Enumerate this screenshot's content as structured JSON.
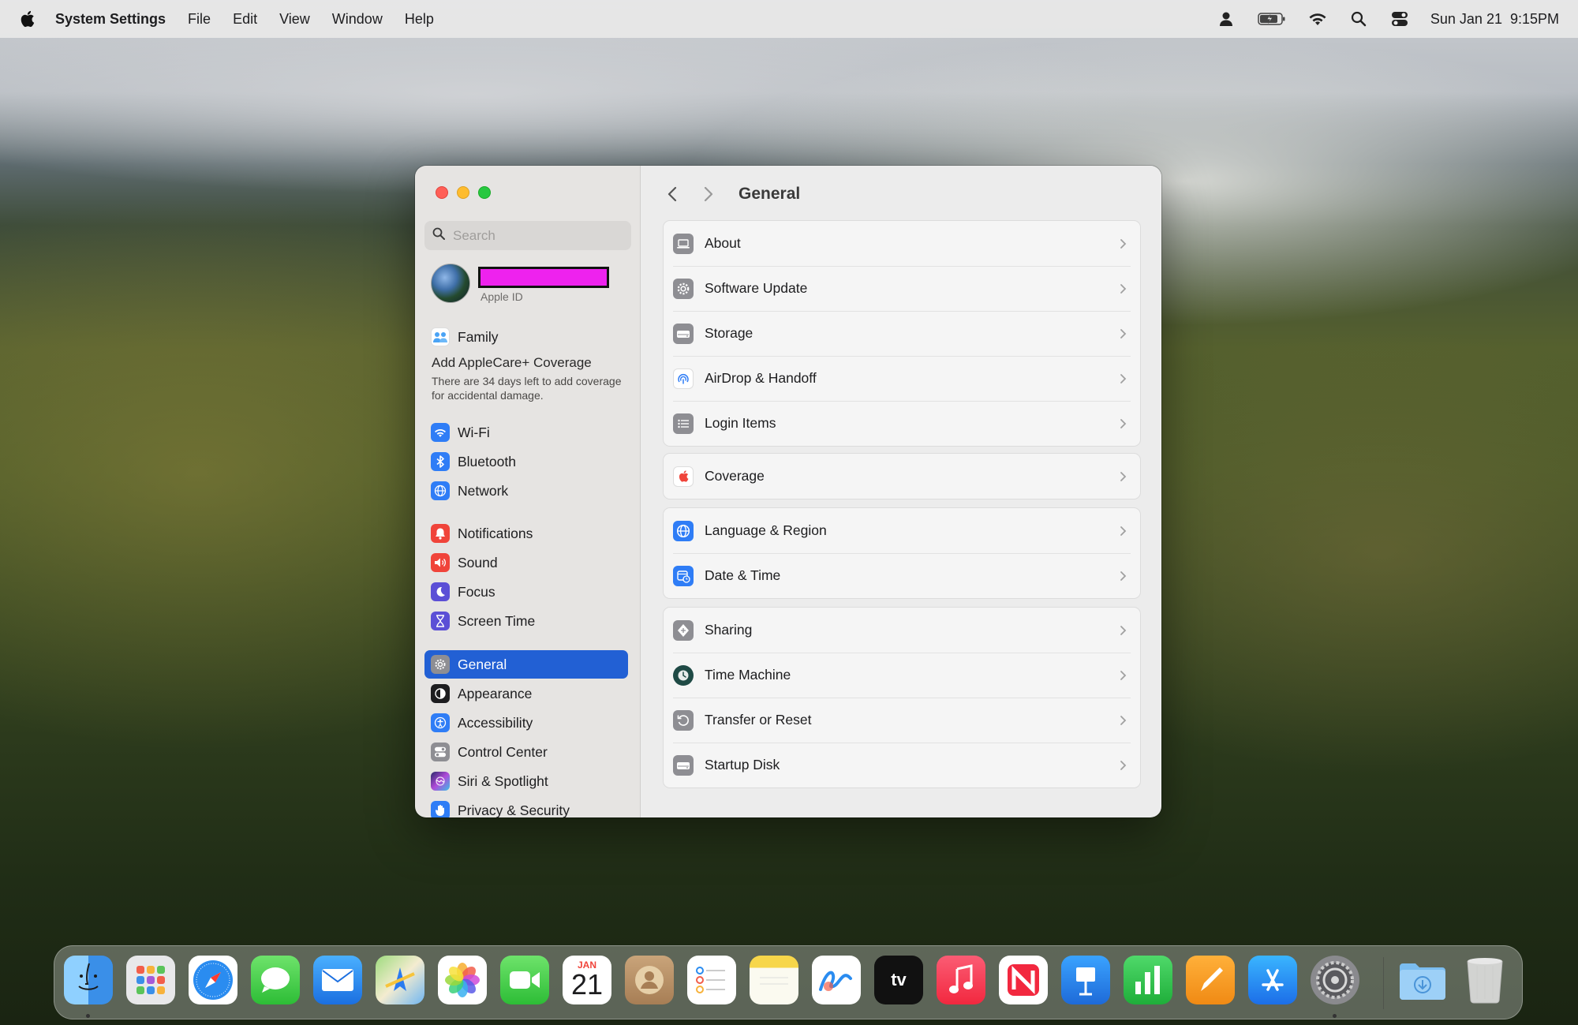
{
  "menubar": {
    "app_name": "System Settings",
    "menus": [
      "File",
      "Edit",
      "View",
      "Window",
      "Help"
    ],
    "datetime": "Sun Jan 21  9:15PM"
  },
  "sidebar": {
    "search_placeholder": "Search",
    "apple_id_caption": "Apple ID",
    "family_label": "Family",
    "applecare_title": "Add AppleCare+ Coverage",
    "applecare_desc": "There are 34 days left to add coverage for accidental damage.",
    "items": [
      {
        "label": "Wi-Fi",
        "icon": "wifi-icon",
        "color": "#2f7df6"
      },
      {
        "label": "Bluetooth",
        "icon": "bluetooth-icon",
        "color": "#2f7df6"
      },
      {
        "label": "Network",
        "icon": "globe-icon",
        "color": "#2f7df6"
      },
      {
        "label": "Notifications",
        "icon": "bell-icon",
        "color": "#f0443a"
      },
      {
        "label": "Sound",
        "icon": "speaker-icon",
        "color": "#f0443a"
      },
      {
        "label": "Focus",
        "icon": "moon-icon",
        "color": "#5b4fd6"
      },
      {
        "label": "Screen Time",
        "icon": "hourglass-icon",
        "color": "#5b4fd6"
      },
      {
        "label": "General",
        "icon": "gear-icon",
        "color": "#8e8e93"
      },
      {
        "label": "Appearance",
        "icon": "appearance-icon",
        "color": "#1d1d1f"
      },
      {
        "label": "Accessibility",
        "icon": "accessibility-icon",
        "color": "#2f7df6"
      },
      {
        "label": "Control Center",
        "icon": "control-center-icon",
        "color": "#8e8e93"
      },
      {
        "label": "Siri & Spotlight",
        "icon": "siri-icon",
        "color": "#b04ad8"
      },
      {
        "label": "Privacy & Security",
        "icon": "hand-icon",
        "color": "#2f7df6"
      }
    ]
  },
  "main": {
    "title": "General",
    "groups": [
      [
        {
          "label": "About",
          "icon": "laptop-icon"
        },
        {
          "label": "Software Update",
          "icon": "gear-badge-icon"
        },
        {
          "label": "Storage",
          "icon": "drive-icon"
        },
        {
          "label": "AirDrop & Handoff",
          "icon": "airdrop-icon"
        },
        {
          "label": "Login Items",
          "icon": "list-icon"
        }
      ],
      [
        {
          "label": "Coverage",
          "icon": "apple-icon"
        }
      ],
      [
        {
          "label": "Language & Region",
          "icon": "globe-icon"
        },
        {
          "label": "Date & Time",
          "icon": "calendar-clock-icon"
        }
      ],
      [
        {
          "label": "Sharing",
          "icon": "sharing-icon"
        },
        {
          "label": "Time Machine",
          "icon": "time-machine-icon"
        },
        {
          "label": "Transfer or Reset",
          "icon": "reset-icon"
        },
        {
          "label": "Startup Disk",
          "icon": "disk-icon"
        }
      ]
    ]
  },
  "dock": {
    "calendar_month": "JAN",
    "calendar_day": "21",
    "apps": [
      "Finder",
      "Launchpad",
      "Safari",
      "Messages",
      "Mail",
      "Maps",
      "Photos",
      "FaceTime",
      "Calendar",
      "Contacts",
      "Reminders",
      "Notes",
      "Freeform",
      "TV",
      "Music",
      "News",
      "Keynote",
      "Numbers",
      "Pages",
      "App Store",
      "System Settings",
      "Downloads",
      "Trash"
    ]
  }
}
